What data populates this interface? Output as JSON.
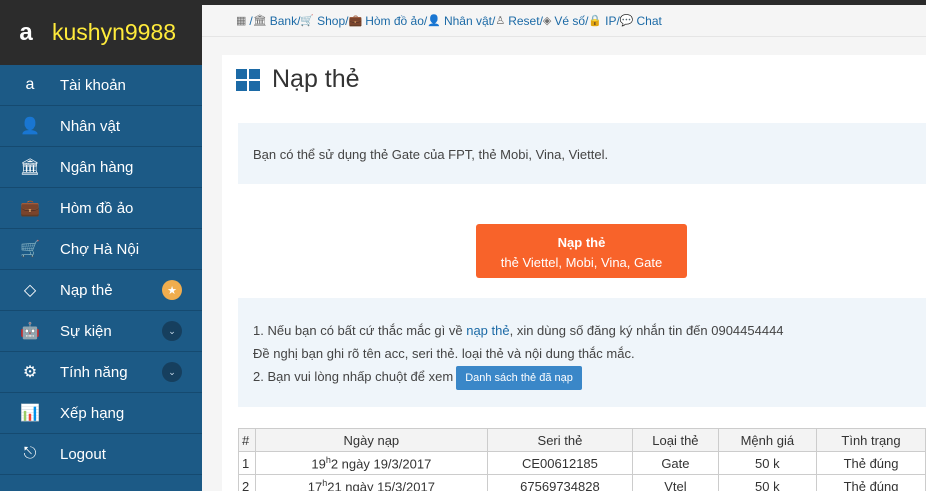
{
  "brand": {
    "logo": "a",
    "name": "kushyn9988"
  },
  "sidebar": {
    "items": [
      {
        "label": "Tài khoản",
        "icon": "amazon-icon",
        "glyph": "a"
      },
      {
        "label": "Nhân vật",
        "icon": "user-icon",
        "glyph": "👤"
      },
      {
        "label": "Ngân hàng",
        "icon": "bank-icon",
        "glyph": "🏛"
      },
      {
        "label": "Hòm đồ ảo",
        "icon": "briefcase-icon",
        "glyph": "💼"
      },
      {
        "label": "Chợ Hà Nội",
        "icon": "cart-icon",
        "glyph": "🛒"
      },
      {
        "label": "Nạp thẻ",
        "icon": "diamond-icon",
        "glyph": "◇",
        "badge": "★"
      },
      {
        "label": "Sự kiện",
        "icon": "android-icon",
        "glyph": "🤖",
        "badge": "⌄"
      },
      {
        "label": "Tính năng",
        "icon": "gears-icon",
        "glyph": "⚙",
        "badge": "⌄"
      },
      {
        "label": "Xếp hạng",
        "icon": "bar-chart-icon",
        "glyph": "📊"
      },
      {
        "label": "Logout",
        "icon": "sign-out-icon",
        "glyph": "⎋"
      }
    ]
  },
  "topbar": {
    "items": [
      {
        "label": "",
        "icon": "calendar-icon",
        "glyph": "▦"
      },
      {
        "label": "Bank",
        "icon": "bank-icon",
        "glyph": "🏛"
      },
      {
        "label": "Shop",
        "icon": "cart-icon",
        "glyph": "🛒"
      },
      {
        "label": "Hòm đồ ảo",
        "icon": "briefcase-icon",
        "glyph": "💼"
      },
      {
        "label": "Nhân vật",
        "icon": "user-icon",
        "glyph": "👤"
      },
      {
        "label": "Reset",
        "icon": "reset-icon",
        "glyph": "♙"
      },
      {
        "label": "Vé số",
        "icon": "ticket-icon",
        "glyph": "◈"
      },
      {
        "label": "IP",
        "icon": "lock-icon",
        "glyph": "🔒"
      },
      {
        "label": "Chat",
        "icon": "chat-icon",
        "glyph": "💬"
      }
    ]
  },
  "page": {
    "title": "Nạp thẻ",
    "info": "Bạn có thể sử dụng thẻ Gate của FPT, thẻ Mobi, Vina, Viettel.",
    "topup_button": {
      "line1": "Nạp thẻ",
      "line2": "thẻ Viettel, Mobi, Vina, Gate"
    },
    "help": {
      "line1_pre": "1. Nếu bạn có bất cứ thắc mắc gì về ",
      "line1_link": "nạp thẻ",
      "line1_post": ", xin dùng số đăng ký nhắn tin đến 0904454444",
      "line2": "Đề nghị bạn ghi rõ tên acc, seri thẻ. loại thẻ và nội dung thắc mắc.",
      "line3": "2. Bạn vui lòng nhấp chuột để xem",
      "list_button": "Danh sách thẻ đã nạp"
    }
  },
  "table": {
    "headers": [
      "#",
      "Ngày nạp",
      "Seri thẻ",
      "Loại thẻ",
      "Mệnh giá",
      "Tình trạng"
    ],
    "rows": [
      {
        "num": "1",
        "date_pre": "19",
        "date_sup": "h",
        "date_post": "2 ngày 19/3/2017",
        "seri": "CE00612185",
        "type": "Gate",
        "value": "50 k",
        "status": "Thẻ đúng"
      },
      {
        "num": "2",
        "date_pre": "17",
        "date_sup": "h",
        "date_post": "21 ngày 15/3/2017",
        "seri": "67569734828",
        "type": "Vtel",
        "value": "50 k",
        "status": "Thẻ đúng"
      }
    ]
  },
  "colors": {
    "sidebar": "#1c5a86",
    "brand_bg": "#2c2c2c",
    "brand_text": "#ffeb3b",
    "orange": "#f8632a",
    "blue_button": "#3a87c8",
    "alert_bg": "#eff5fa"
  }
}
